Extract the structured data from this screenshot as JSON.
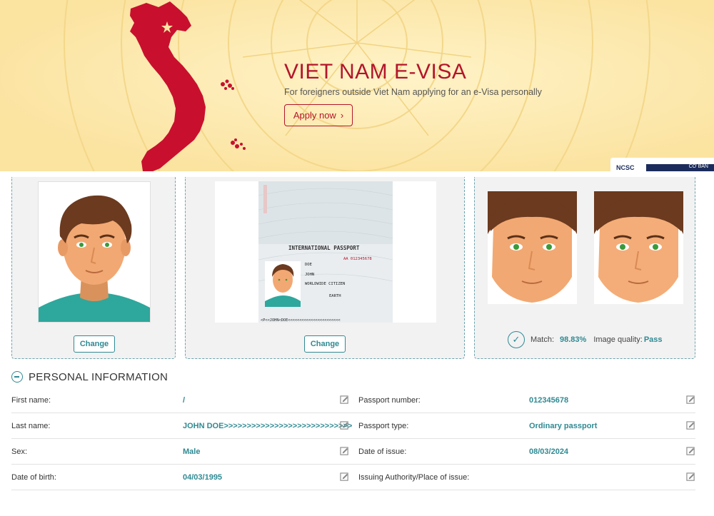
{
  "banner": {
    "title": "VIET NAM E-VISA",
    "subtitle": "For foreigners outside Viet Nam applying for an e-Visa personally",
    "apply_label": "Apply now",
    "badge_text": "NCSC",
    "badge_level": "CƠ BẢN",
    "accent_color": "#b3152b",
    "background_color": "#fbe6a3"
  },
  "photos": {
    "change_label": "Change",
    "passport": {
      "title": "INTERNATIONAL PASSPORT",
      "number": "AA 012345678",
      "surname": "DOE",
      "given_name": "JOHN",
      "nationality": "WORLDWIDE CITIZEN",
      "place_of_birth": "EARTH",
      "mrz": "<P<<JOHN<DOE<<<<<<<<<<<<<<<<<<<<<<<"
    },
    "match_label": "Match:",
    "match_value": "98.83%",
    "quality_label": "Image quality:",
    "quality_value": "Pass"
  },
  "section": {
    "title": "PERSONAL INFORMATION",
    "rows": [
      {
        "label1": "First name:",
        "value1": "/",
        "label2": "Passport number:",
        "value2": "012345678"
      },
      {
        "label1": "Last name:",
        "value1": "JOHN DOE>>>>>>>>>>>>>>>>>>>>>>>>>>>>",
        "label2": "Passport type:",
        "value2": "Ordinary passport"
      },
      {
        "label1": "Sex:",
        "value1": "Male",
        "label2": "Date of issue:",
        "value2": "08/03/2024"
      },
      {
        "label1": "Date of birth:",
        "value1": "04/03/1995",
        "label2": "Issuing Authority/Place of issue:",
        "value2": ""
      }
    ]
  },
  "theme": {
    "teal": "#2f8a93"
  }
}
